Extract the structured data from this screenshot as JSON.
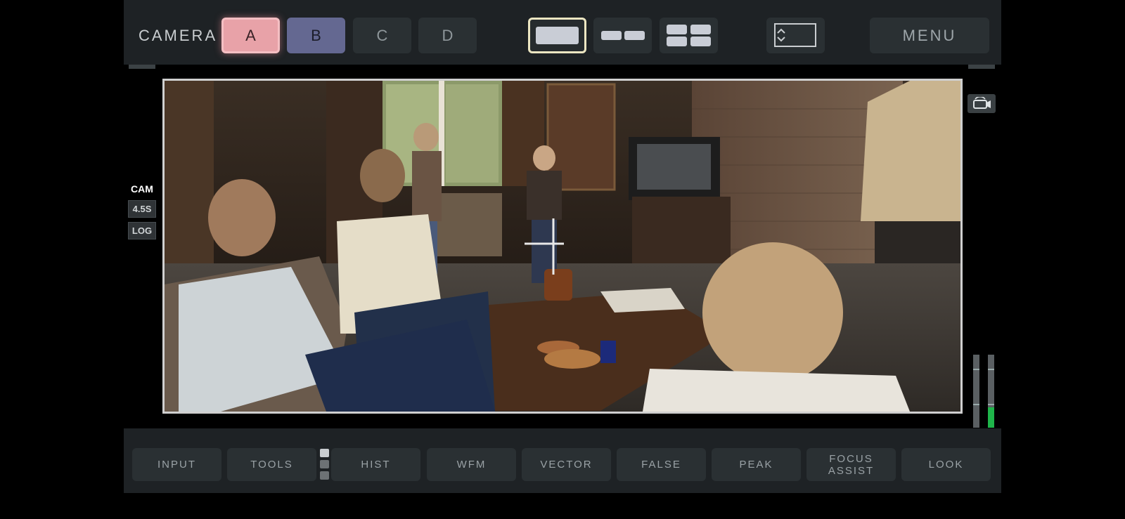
{
  "header": {
    "camera_label": "CAMERA",
    "cameras": [
      "A",
      "B",
      "C",
      "D"
    ],
    "active_camera": "A",
    "menu_label": "MENU"
  },
  "side": {
    "cam_label": "CAM",
    "fps_badge": "4.5S",
    "log_badge": "LOG"
  },
  "tools": [
    "INPUT",
    "TOOLS",
    "HIST",
    "WFM",
    "VECTOR",
    "FALSE",
    "PEAK",
    "FOCUS ASSIST",
    "LOOK"
  ],
  "colors": {
    "accent_camera_a": "#e8a2a8",
    "accent_camera_b": "#646891",
    "meter_green": "#1fb54a",
    "panel": "#1e2225",
    "button": "#2a3033"
  },
  "audio_meters": {
    "left_level": 0.0,
    "right_level": 0.28
  }
}
